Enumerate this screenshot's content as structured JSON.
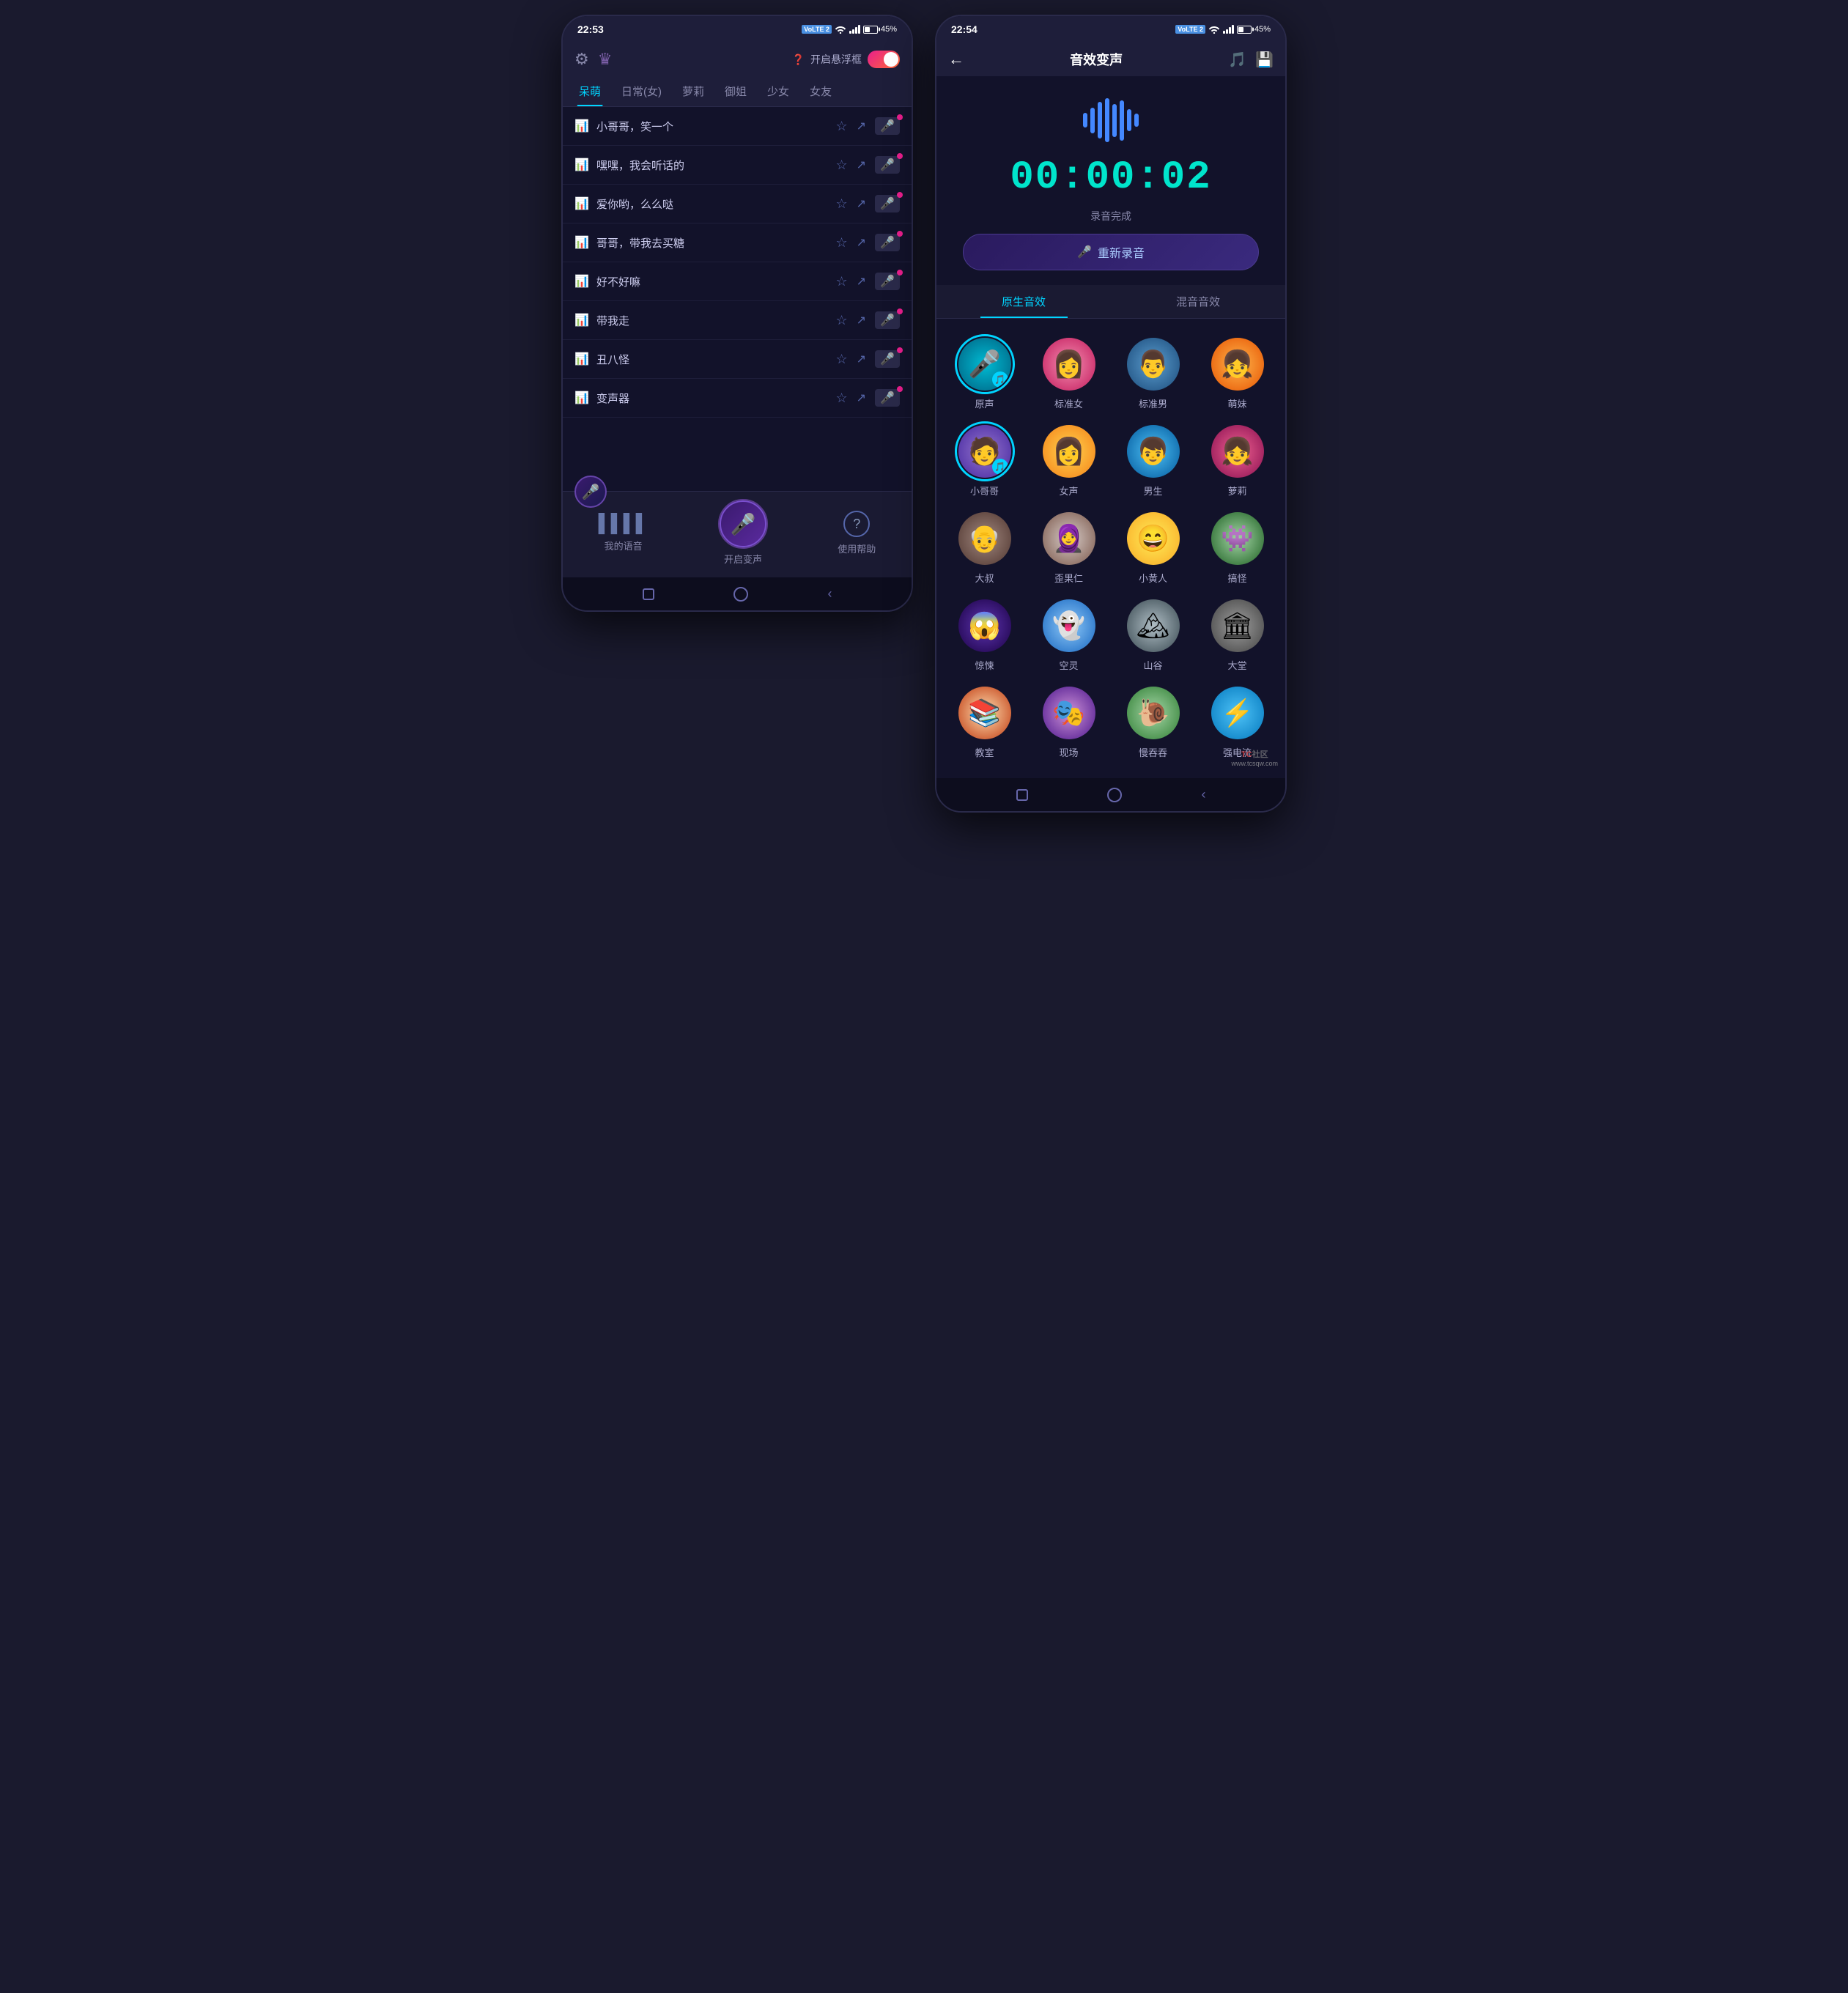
{
  "phone1": {
    "status_bar": {
      "time": "22:53",
      "battery": "45%"
    },
    "header": {
      "floating_frame_label": "开启悬浮框",
      "toggle_state": "on"
    },
    "tabs": [
      {
        "label": "呆萌",
        "active": true
      },
      {
        "label": "日常(女)",
        "active": false
      },
      {
        "label": "萝莉",
        "active": false
      },
      {
        "label": "御姐",
        "active": false
      },
      {
        "label": "少女",
        "active": false
      },
      {
        "label": "女友",
        "active": false
      }
    ],
    "songs": [
      {
        "title": "小哥哥，笑一个",
        "has_new": true
      },
      {
        "title": "嘿嘿，我会听话的",
        "has_new": true
      },
      {
        "title": "爱你哟，么么哒",
        "has_new": true
      },
      {
        "title": "哥哥，带我去买糖",
        "has_new": true
      },
      {
        "title": "好不好嘛",
        "has_new": true
      },
      {
        "title": "带我走",
        "has_new": true
      },
      {
        "title": "丑八怪",
        "has_new": true
      },
      {
        "title": "变声器",
        "has_new": true
      }
    ],
    "bottom_nav": [
      {
        "label": "我的语音",
        "icon": "waveform"
      },
      {
        "label": "开启变声",
        "icon": "mic",
        "is_center": true
      },
      {
        "label": "使用帮助",
        "icon": "question"
      }
    ]
  },
  "phone2": {
    "status_bar": {
      "time": "22:54",
      "battery": "45%"
    },
    "header": {
      "title": "音效变声",
      "back": "←"
    },
    "timer": "00:00:02",
    "recording_status": "录音完成",
    "re_record_button": "重新录音",
    "tabs": [
      {
        "label": "原生音效",
        "active": true
      },
      {
        "label": "混音音效",
        "active": false
      }
    ],
    "effects": [
      {
        "label": "原声",
        "avatar": "av-teal",
        "icon": "🎤",
        "selected": true
      },
      {
        "label": "标准女",
        "avatar": "av-pink",
        "icon": "👩",
        "selected": false
      },
      {
        "label": "标准男",
        "avatar": "av-blue",
        "icon": "👨",
        "selected": false
      },
      {
        "label": "萌妹",
        "avatar": "av-orange",
        "icon": "👧",
        "selected": false
      },
      {
        "label": "小哥哥",
        "avatar": "av-purple",
        "icon": "🧑",
        "selected": true
      },
      {
        "label": "女声",
        "avatar": "av-yellow",
        "icon": "👩",
        "selected": false
      },
      {
        "label": "男生",
        "avatar": "av-blue",
        "icon": "👦",
        "selected": false
      },
      {
        "label": "萝莉",
        "avatar": "av-pink",
        "icon": "👧",
        "selected": false
      },
      {
        "label": "大叔",
        "avatar": "av-brown",
        "icon": "👴",
        "selected": false
      },
      {
        "label": "歪果仁",
        "avatar": "av-beige",
        "icon": "🧕",
        "selected": false
      },
      {
        "label": "小黄人",
        "avatar": "av-minion",
        "icon": "😃",
        "selected": false
      },
      {
        "label": "搞怪",
        "avatar": "av-monster",
        "icon": "👾",
        "selected": false
      },
      {
        "label": "惊悚",
        "avatar": "av-scary",
        "icon": "😱",
        "selected": false
      },
      {
        "label": "空灵",
        "avatar": "av-ghost",
        "icon": "👻",
        "selected": false
      },
      {
        "label": "山谷",
        "avatar": "av-mountain",
        "icon": "🏔️",
        "selected": false
      },
      {
        "label": "大堂",
        "avatar": "av-hall",
        "icon": "🏛️",
        "selected": false
      },
      {
        "label": "教室",
        "avatar": "av-classroom",
        "icon": "📚",
        "selected": false
      },
      {
        "label": "现场",
        "avatar": "av-scene",
        "icon": "🎭",
        "selected": false
      },
      {
        "label": "慢吞吞",
        "avatar": "av-slow",
        "icon": "🐌",
        "selected": false
      },
      {
        "label": "强电流",
        "avatar": "av-electric",
        "icon": "⚡",
        "selected": false
      }
    ]
  },
  "watermark": {
    "brand": "TC社区",
    "url": "www.tcsqw.com"
  }
}
